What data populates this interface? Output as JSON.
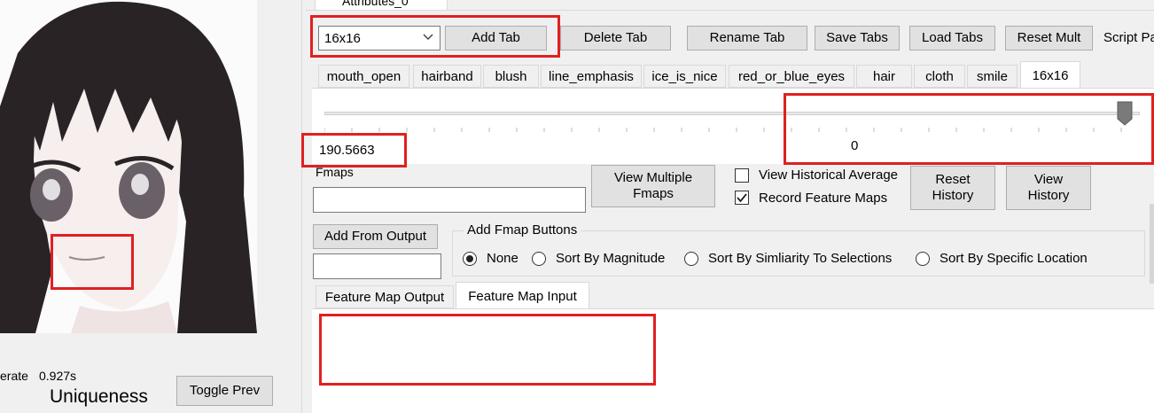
{
  "left_panel": {
    "generate_label_partial": "erate",
    "generate_time": "0.927s",
    "uniqueness_label": "Uniqueness",
    "toggle_prev_label": "Toggle Prev"
  },
  "top_tabs": {
    "partial_tab_label": "Attributes_0"
  },
  "toolbar": {
    "tab_select_value": "16x16",
    "add_tab": "Add Tab",
    "delete_tab": "Delete Tab",
    "rename_tab": "Rename Tab",
    "save_tabs": "Save Tabs",
    "load_tabs": "Load Tabs",
    "reset_mult": "Reset Mult",
    "script_partial": "Script Pa"
  },
  "feature_tabs": [
    "mouth_open",
    "hairband",
    "blush",
    "line_emphasis",
    "ice_is_nice",
    "red_or_blue_eyes",
    "hair",
    "cloth",
    "smile",
    "16x16"
  ],
  "slider": {
    "value_text": "190.5663",
    "center_value": "0"
  },
  "fmaps": {
    "label": "Fmaps",
    "input_value": "",
    "view_multiple": "View Multiple\nFmaps",
    "view_historical_average": "View Historical Average",
    "record_feature_maps": "Record Feature Maps",
    "reset_history": "Reset\nHistory",
    "view_history": "View\nHistory",
    "add_from_output": "Add From Output"
  },
  "add_fmap_group": {
    "title": "Add Fmap Buttons",
    "options": [
      "None",
      "Sort By Magnitude",
      "Sort By Simliarity To Selections",
      "Sort By Specific Location"
    ],
    "selected": "None"
  },
  "output_tabs": [
    "Feature Map Output",
    "Feature Map Input"
  ]
}
